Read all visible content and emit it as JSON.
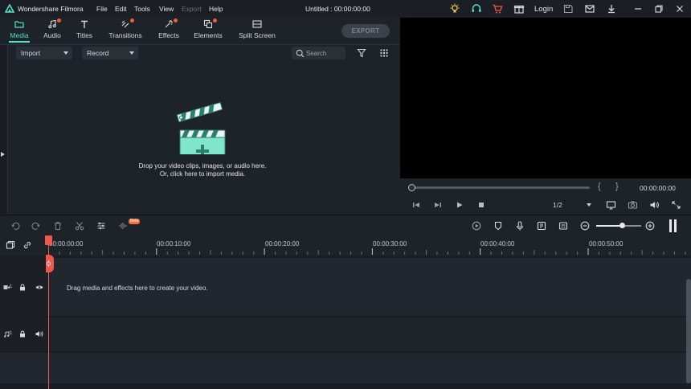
{
  "app": {
    "name": "Wondershare Filmora",
    "title": "Untitled : 00:00:00:00",
    "accent_color": "#4ee5c6",
    "notification_color": "#f25a3c"
  },
  "menu": [
    {
      "label": "File",
      "enabled": true
    },
    {
      "label": "Edit",
      "enabled": true
    },
    {
      "label": "Tools",
      "enabled": true
    },
    {
      "label": "View",
      "enabled": true
    },
    {
      "label": "Export",
      "enabled": false
    },
    {
      "label": "Help",
      "enabled": true
    }
  ],
  "titlebar": {
    "login_label": "Login",
    "icons": [
      "bulb-icon",
      "headset-icon",
      "cart-icon",
      "gift-icon",
      "save-icon",
      "mail-icon",
      "download-icon",
      "minimize-icon",
      "restore-icon",
      "close-icon"
    ]
  },
  "tabs": [
    {
      "label": "Media",
      "icon": "folder-icon",
      "active": true,
      "badge": false
    },
    {
      "label": "Audio",
      "icon": "music-icon",
      "active": false,
      "badge": true
    },
    {
      "label": "Titles",
      "icon": "text-icon",
      "active": false,
      "badge": false
    },
    {
      "label": "Transitions",
      "icon": "transition-icon",
      "active": false,
      "badge": true
    },
    {
      "label": "Effects",
      "icon": "effects-icon",
      "active": false,
      "badge": true
    },
    {
      "label": "Elements",
      "icon": "elements-icon",
      "active": false,
      "badge": true
    },
    {
      "label": "Split Screen",
      "icon": "split-screen-icon",
      "active": false,
      "badge": false
    }
  ],
  "export_label": "EXPORT",
  "media": {
    "import_label": "Import",
    "record_label": "Record",
    "search_placeholder": "Search",
    "drop_line1": "Drop your video clips, images, or audio here.",
    "drop_line2": "Or, click here to import media."
  },
  "player": {
    "time": "00:00:00:00",
    "ratio": "1/2",
    "progress": 0
  },
  "timeline": {
    "ruler": [
      "00:00:00:00",
      "00:00:10:00",
      "00:00:20:00",
      "00:00:30:00",
      "00:00:40:00",
      "00:00:50:00"
    ],
    "beta_label": "Beta",
    "drag_hint": "Drag media and effects here to create your video.",
    "video_track_num": "1",
    "audio_track_num": "1",
    "zoom_level": 0.55
  }
}
